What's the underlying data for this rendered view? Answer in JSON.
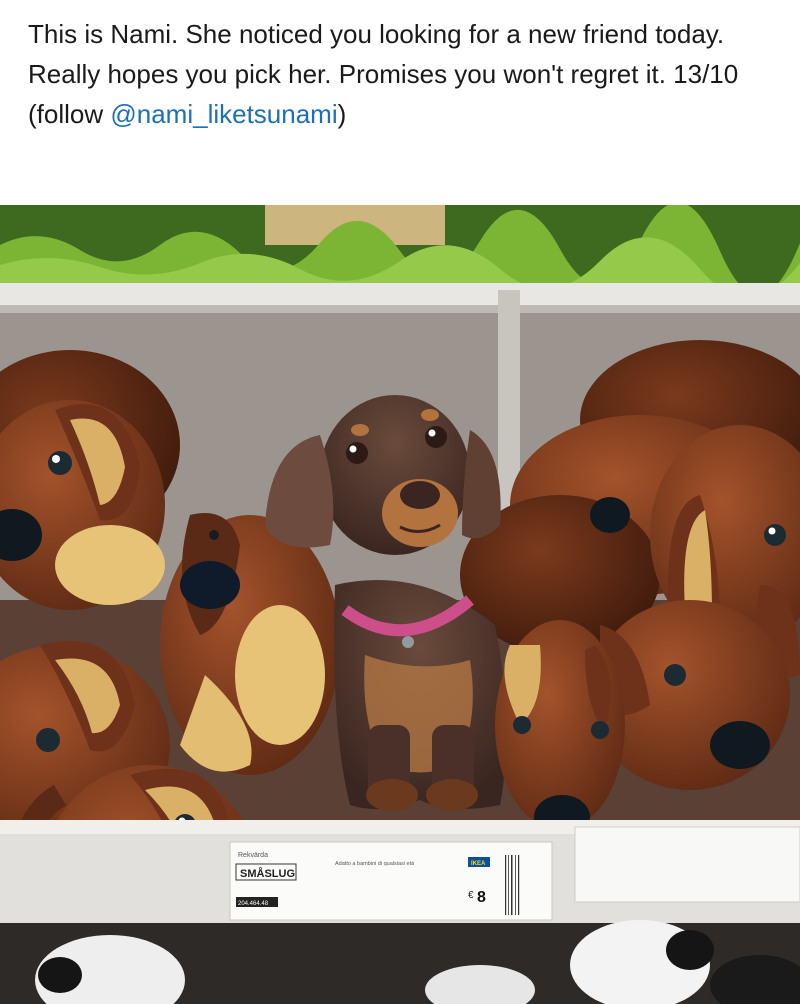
{
  "post": {
    "caption_text": "This is Nami. She noticed you looking for a new friend today. Really hopes you pick her. Promises you won't regret it. 13/10  (follow ",
    "mention": "@nami_liketsunami",
    "caption_end": ")",
    "mention_color": "#1d6fb8"
  },
  "photo": {
    "price_tag": {
      "brand_small": "Rekvärda",
      "product_name": "SMÅSLUG",
      "age_line": "Adatto a bambini di qualsiasi età",
      "price_symbol": "€",
      "price": "8",
      "article_number": "204.464.48",
      "ikea_logo": "IKEA"
    }
  }
}
